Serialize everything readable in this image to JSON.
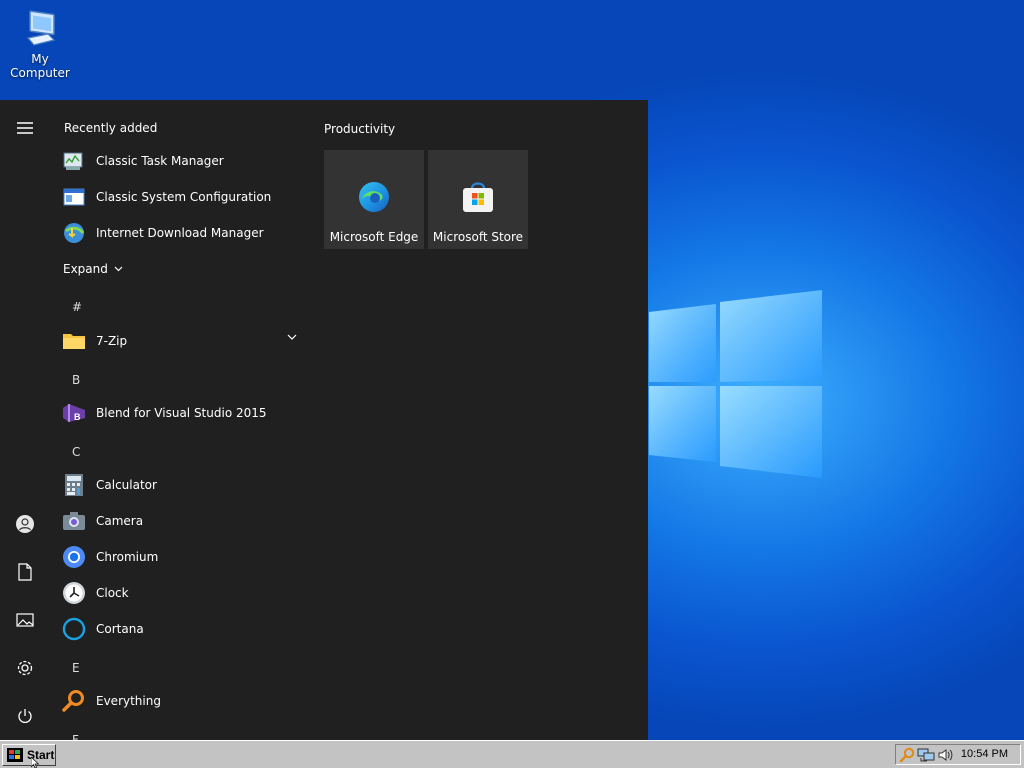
{
  "desktop": {
    "icons": [
      {
        "label": "My Computer",
        "icon": "computer-icon"
      }
    ]
  },
  "start_menu": {
    "rail": [
      {
        "icon": "hamburger-icon"
      },
      {
        "icon": "user-icon"
      },
      {
        "icon": "documents-icon"
      },
      {
        "icon": "pictures-icon"
      },
      {
        "icon": "settings-icon"
      },
      {
        "icon": "power-icon"
      }
    ],
    "recently_added_label": "Recently added",
    "recent": [
      {
        "label": "Classic Task Manager",
        "icon": "task-manager-icon"
      },
      {
        "label": "Classic System Configuration",
        "icon": "system-config-icon"
      },
      {
        "label": "Internet Download Manager",
        "icon": "idm-icon"
      }
    ],
    "expand_label": "Expand",
    "letters": {
      "hash": "#",
      "b": "B",
      "c": "C",
      "e": "E",
      "f": "F"
    },
    "apps": {
      "seven_zip": "7-Zip",
      "blend": "Blend for Visual Studio 2015",
      "calculator": "Calculator",
      "camera": "Camera",
      "chromium": "Chromium",
      "clock": "Clock",
      "cortana": "Cortana",
      "everything": "Everything"
    },
    "tiles_group": "Productivity",
    "tiles": [
      {
        "label": "Microsoft Edge",
        "icon": "edge-icon"
      },
      {
        "label": "Microsoft Store",
        "icon": "store-icon"
      }
    ]
  },
  "taskbar": {
    "start_label": "Start",
    "clock": "10:54 PM",
    "tray_icons": [
      "search-icon",
      "network-icon",
      "volume-icon"
    ]
  },
  "colors": {
    "start_bg": "#202020",
    "tile_bg": "#333333",
    "desktop_blue": "#0a55cf",
    "taskbar": "#c3c3c3"
  }
}
